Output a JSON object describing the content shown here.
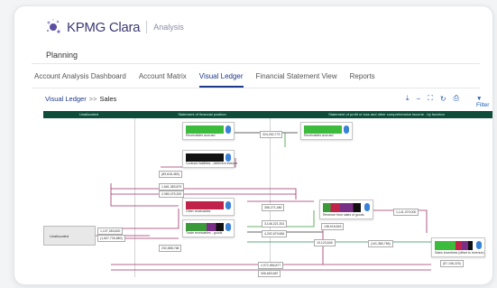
{
  "app": {
    "name": "KPMG Clara",
    "section": "Analysis"
  },
  "page": {
    "title": "Planning"
  },
  "tabs": [
    {
      "label": "Account Analysis Dashboard",
      "active": false
    },
    {
      "label": "Account Matrix",
      "active": false
    },
    {
      "label": "Visual Ledger",
      "active": true
    },
    {
      "label": "Financial Statement View",
      "active": false
    },
    {
      "label": "Reports",
      "active": false
    }
  ],
  "breadcrumb": {
    "root": "Visual Ledger",
    "separator": ">>",
    "current": "Sales"
  },
  "toolbar": {
    "filter_label": "Filter"
  },
  "ledger": {
    "columns": [
      {
        "title": "Unallocated"
      },
      {
        "title": "Statement of financial position"
      },
      {
        "title": "Statement of profit or loss and other comprehensive income - by function"
      }
    ],
    "unallocated_label": "Unallocated",
    "nodes": [
      {
        "label": "Receivables accrued",
        "color": "#3dbb3d"
      },
      {
        "label": "Contract liabilities - deferred revenue",
        "color": "#111111"
      },
      {
        "label": "Other receivables",
        "color": "#c0224a"
      },
      {
        "label": "Trade receivables - goods",
        "color": "#3a9a3a"
      },
      {
        "label": "Receivables accrued",
        "color": "#3dbb3d"
      },
      {
        "label": "Revenue from sales of goods",
        "color": "#7a2f86"
      },
      {
        "label": "Sales incentives (offset to revenue)",
        "color": "#3dbb3d"
      }
    ],
    "amounts": [
      "324,262,773",
      "(89,618,480)",
      "1,661,383,879",
      "2,980,475,300",
      "356,271,480",
      "3,146,221,301",
      "4,202,679,684",
      "1,107,283,820",
      "(1,607,726,880)",
      "1,141,379,000",
      "138,918,843",
      "202,888,768",
      "19,123,648",
      "(141,380,756)",
      "2,072,956,877",
      "306,663,687",
      "(57,108,220)"
    ]
  }
}
